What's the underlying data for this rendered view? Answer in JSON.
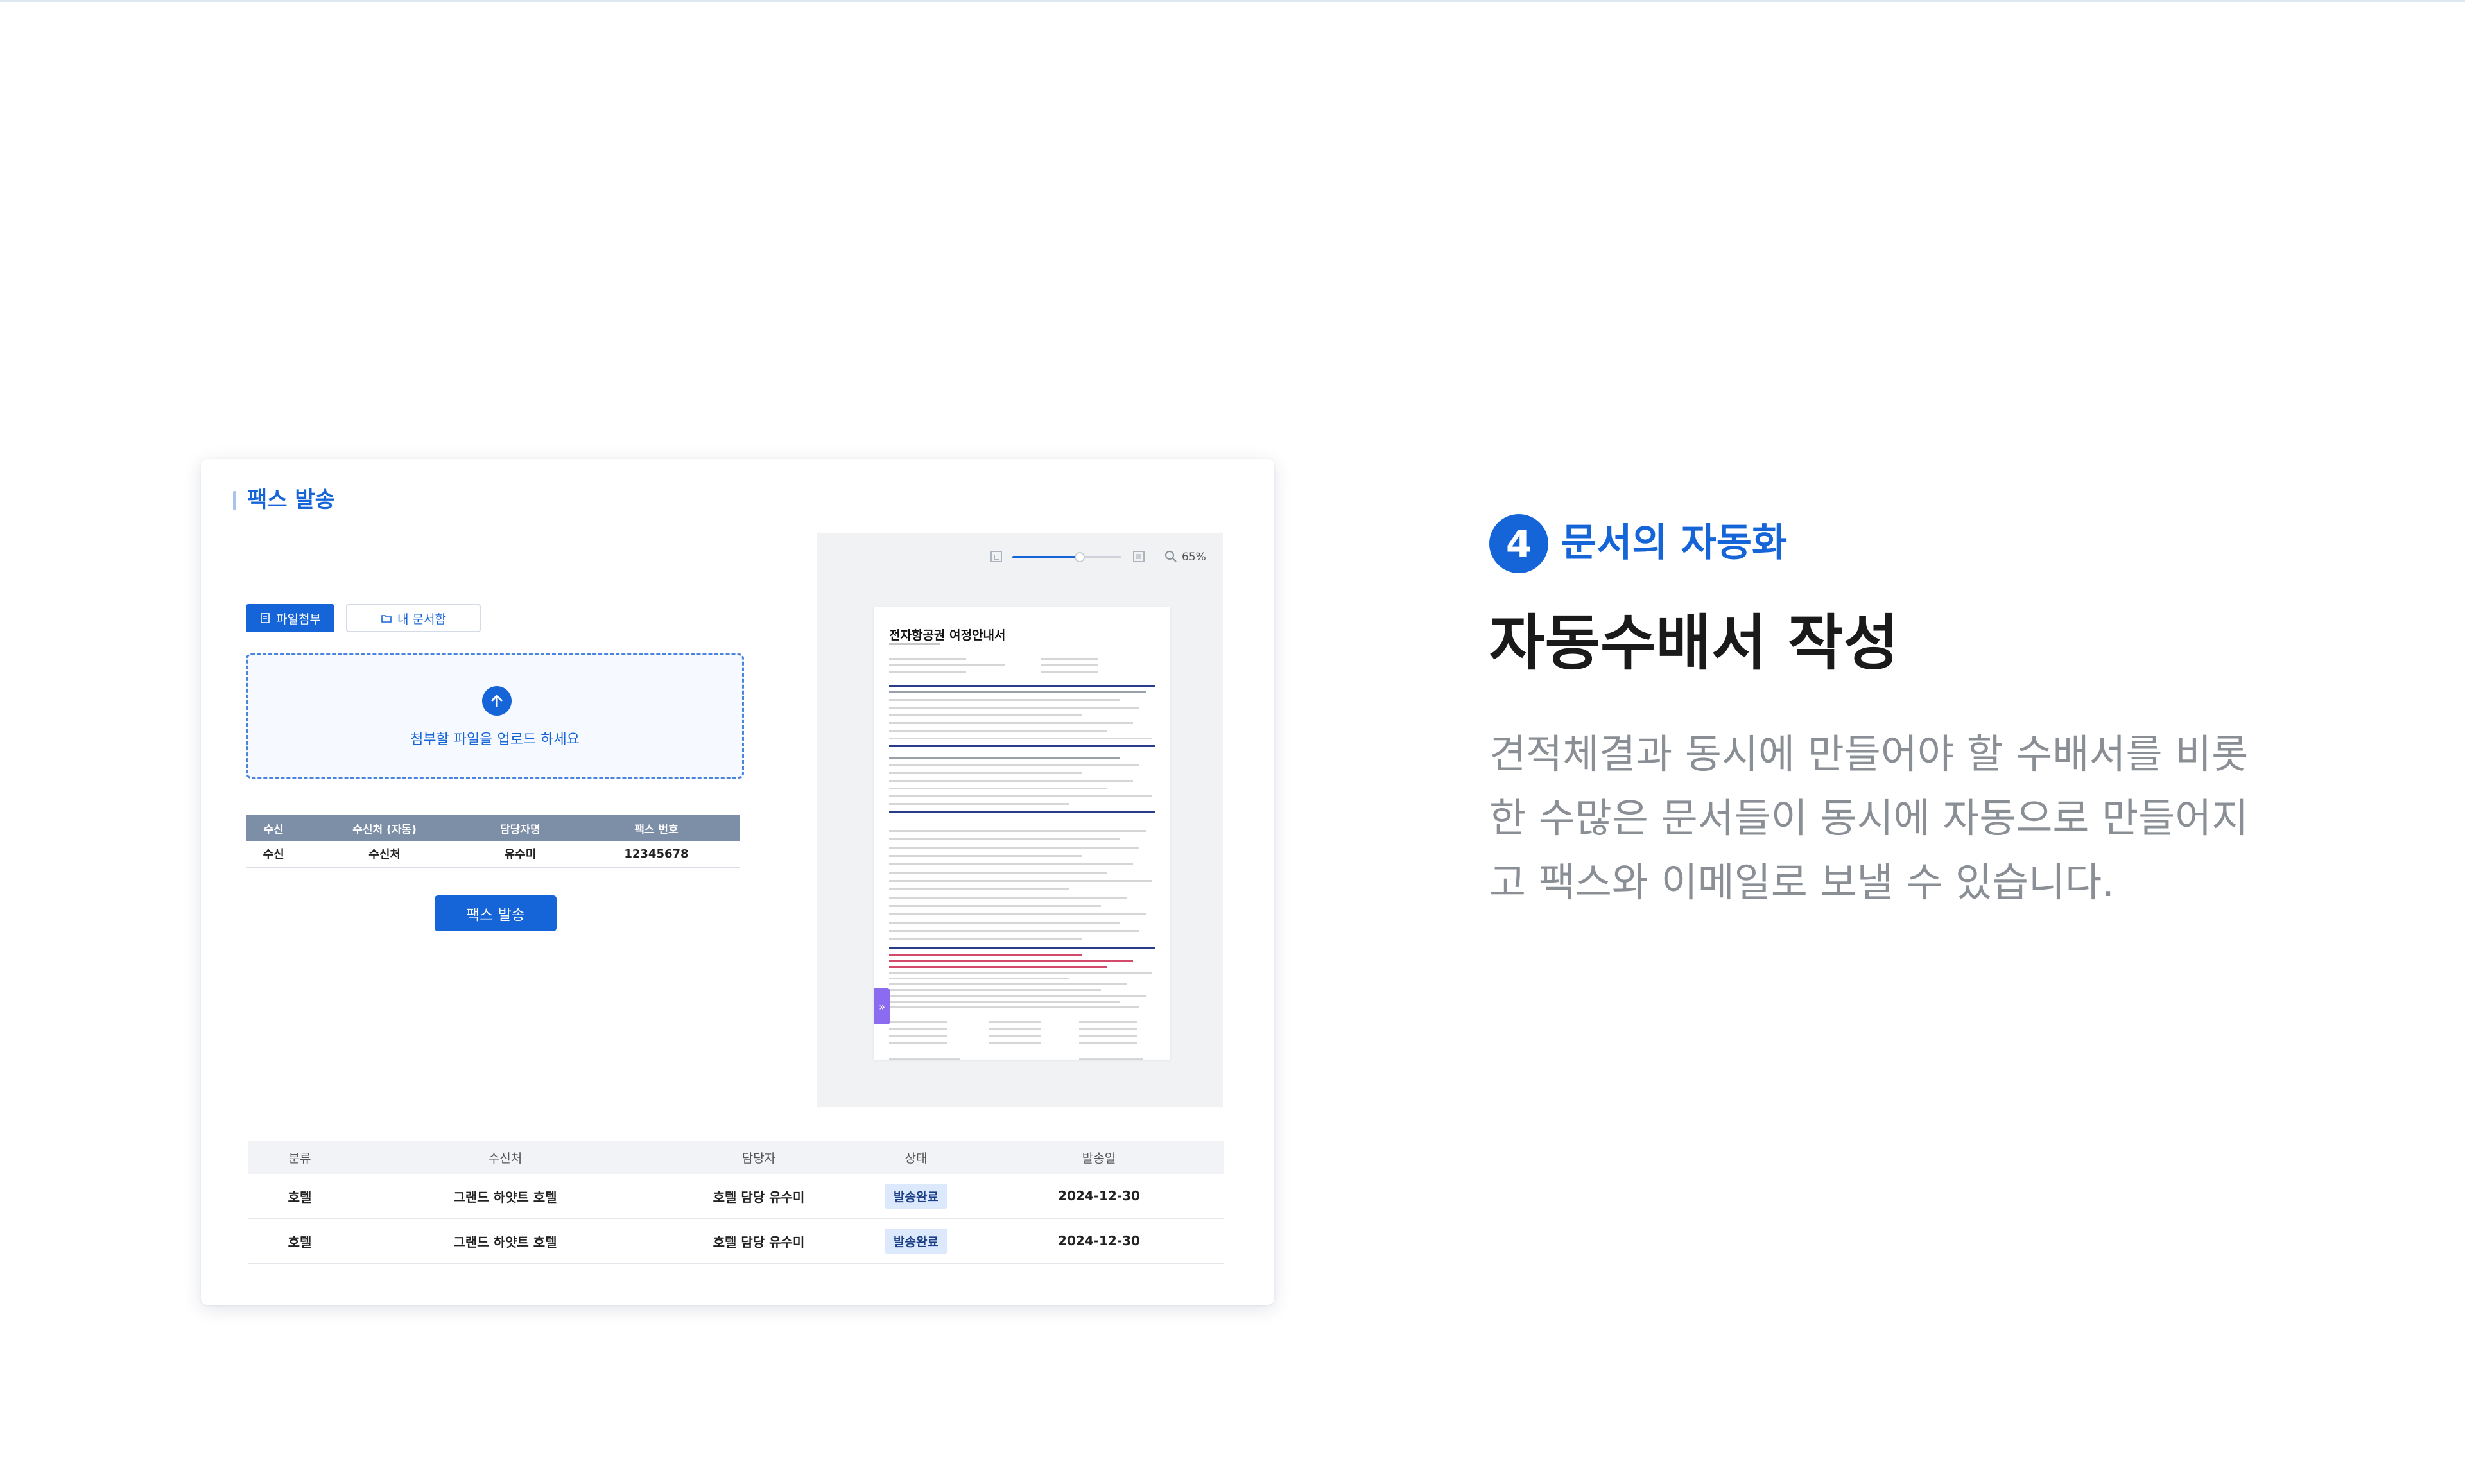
{
  "panel": {
    "title": "팩스 발송",
    "tabs": {
      "attach": "파일첨부",
      "my_docs": "내 문서함"
    },
    "upload_prompt": "첨부할 파일을 업로드 하세요",
    "recipient_table": {
      "headers": [
        "수신",
        "수신처 (자동)",
        "담당자명",
        "팩스 번호"
      ],
      "row": [
        "수신",
        "수신처",
        "유수미",
        "12345678"
      ]
    },
    "send_button": "팩스 발송"
  },
  "preview": {
    "zoom_level": "65%",
    "zoom_fraction": 0.62,
    "document_title": "전자항공권 여정안내서"
  },
  "history": {
    "headers": [
      "분류",
      "수신처",
      "담당자",
      "상태",
      "발송일"
    ],
    "rows": [
      [
        "호텔",
        "그랜드 하얏트 호텔",
        "호텔 담당 유수미",
        "발송완료",
        "2024-12-30"
      ],
      [
        "호텔",
        "그랜드 하얏트 호텔",
        "호텔 담당 유수미",
        "발송완료",
        "2024-12-30"
      ]
    ]
  },
  "feature": {
    "step_number": "4",
    "step_label": "문서의 자동화",
    "title": "자동수배서 작성",
    "description_lines": [
      "견적체결과 동시에 만들어야 할 수배서를 비롯",
      "한 수많은 문서들이 동시에 자동으로 만들어지",
      "고 팩스와 이메일로 보낼 수 있습니다."
    ]
  },
  "colors": {
    "accent": "#1565d8",
    "badge_bg": "#dce8fb",
    "table_head": "#7d8ea7",
    "muted_text": "#8a8f96"
  }
}
